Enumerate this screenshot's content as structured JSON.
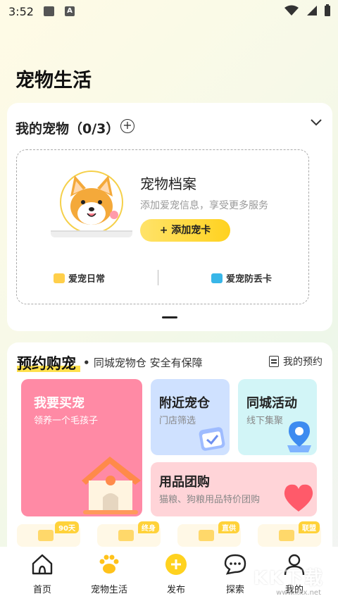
{
  "status": {
    "time": "3:52"
  },
  "page": {
    "title": "宠物生活"
  },
  "my_pets": {
    "heading": "我的宠物（0/3）",
    "archive_title": "宠物档案",
    "archive_subtitle": "添加爱宠信息，享受更多服务",
    "add_button": "+ 添加宠卡",
    "link_daily": "爱宠日常",
    "link_lost": "爱宠防丢卡"
  },
  "booking": {
    "title": "预约购宠",
    "subtitle": "同城宠物仓 安全有保障",
    "my_appointments": "我的预约",
    "tiles": {
      "buy": {
        "title": "我要买宠",
        "subtitle": "领养一个毛孩子"
      },
      "nearby": {
        "title": "附近宠仓",
        "subtitle": "门店筛选"
      },
      "city": {
        "title": "同城活动",
        "subtitle": "线下集聚"
      },
      "group": {
        "title": "用品团购",
        "subtitle": "猫粮、狗粮用品特价团购"
      }
    },
    "mini_badges": [
      "90天",
      "终身",
      "直供",
      "联盟"
    ]
  },
  "tabbar": [
    {
      "label": "首页",
      "icon": "home-icon"
    },
    {
      "label": "宠物生活",
      "icon": "paw-icon"
    },
    {
      "label": "发布",
      "icon": "plus-icon"
    },
    {
      "label": "探索",
      "icon": "chat-icon"
    },
    {
      "label": "我的",
      "icon": "user-icon"
    }
  ],
  "watermark": {
    "text": "KK下载",
    "url": "www.kkx.net"
  },
  "colors": {
    "accent": "#ffd21f",
    "pink": "#ff8aa5",
    "blue": "#cfe1ff",
    "cyan": "#d2f5f7",
    "rose": "#ffd4d8"
  }
}
